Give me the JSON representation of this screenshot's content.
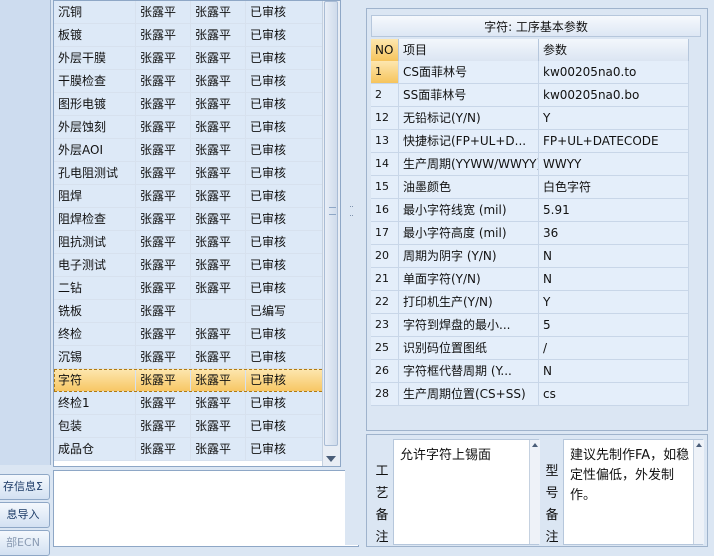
{
  "sidebar": {
    "buttons": [
      {
        "label": "存信息Σ"
      },
      {
        "label": "息导入"
      },
      {
        "label": "部ECN"
      }
    ]
  },
  "process_grid": {
    "rows": [
      {
        "step": "沉铜",
        "c1": "张露平",
        "c2": "张露平",
        "status": "已审核"
      },
      {
        "step": "板镀",
        "c1": "张露平",
        "c2": "张露平",
        "status": "已审核"
      },
      {
        "step": "外层干膜",
        "c1": "张露平",
        "c2": "张露平",
        "status": "已审核"
      },
      {
        "step": "干膜检查",
        "c1": "张露平",
        "c2": "张露平",
        "status": "已审核"
      },
      {
        "step": "图形电镀",
        "c1": "张露平",
        "c2": "张露平",
        "status": "已审核"
      },
      {
        "step": "外层蚀刻",
        "c1": "张露平",
        "c2": "张露平",
        "status": "已审核"
      },
      {
        "step": "外层AOI",
        "c1": "张露平",
        "c2": "张露平",
        "status": "已审核"
      },
      {
        "step": "孔电阻测试",
        "c1": "张露平",
        "c2": "张露平",
        "status": "已审核"
      },
      {
        "step": "阻焊",
        "c1": "张露平",
        "c2": "张露平",
        "status": "已审核"
      },
      {
        "step": "阻焊检查",
        "c1": "张露平",
        "c2": "张露平",
        "status": "已审核"
      },
      {
        "step": "阻抗测试",
        "c1": "张露平",
        "c2": "张露平",
        "status": "已审核"
      },
      {
        "step": "电子测试",
        "c1": "张露平",
        "c2": "张露平",
        "status": "已审核"
      },
      {
        "step": "二钻",
        "c1": "张露平",
        "c2": "张露平",
        "status": "已审核"
      },
      {
        "step": "铣板",
        "c1": "张露平",
        "c2": "",
        "status": "已编写"
      },
      {
        "step": "终检",
        "c1": "张露平",
        "c2": "张露平",
        "status": "已审核"
      },
      {
        "step": "沉锡",
        "c1": "张露平",
        "c2": "张露平",
        "status": "已审核"
      },
      {
        "step": "字符",
        "c1": "张露平",
        "c2": "张露平",
        "status": "已审核"
      },
      {
        "step": "终检1",
        "c1": "张露平",
        "c2": "张露平",
        "status": "已审核"
      },
      {
        "step": "包装",
        "c1": "张露平",
        "c2": "张露平",
        "status": "已审核"
      },
      {
        "step": "成品仓",
        "c1": "张露平",
        "c2": "张露平",
        "status": "已审核"
      }
    ],
    "selected_step": "字符"
  },
  "params": {
    "title": "字符: 工序基本参数",
    "headers": {
      "no": "NO",
      "item": "项目",
      "param": "参数"
    },
    "rows": [
      {
        "no": "1",
        "item": "CS面菲林号",
        "value": "kw00205na0.to"
      },
      {
        "no": "2",
        "item": "SS面菲林号",
        "value": "kw00205na0.bo"
      },
      {
        "no": "12",
        "item": "无铅标记(Y/N)",
        "value": "Y"
      },
      {
        "no": "13",
        "item": "快捷标记(FP+UL+D...",
        "value": "FP+UL+DATECODE"
      },
      {
        "no": "14",
        "item": "生产周期(YYWW/WWYY)",
        "value": "WWYY"
      },
      {
        "no": "15",
        "item": "油墨颜色",
        "value": "白色字符"
      },
      {
        "no": "16",
        "item": "最小字符线宽 (mil)",
        "value": "5.91"
      },
      {
        "no": "17",
        "item": "最小字符高度 (mil)",
        "value": "36"
      },
      {
        "no": "20",
        "item": "周期为阴字 (Y/N)",
        "value": "N"
      },
      {
        "no": "21",
        "item": "单面字符(Y/N)",
        "value": "N"
      },
      {
        "no": "22",
        "item": "打印机生产(Y/N)",
        "value": "Y"
      },
      {
        "no": "23",
        "item": "字符到焊盘的最小...",
        "value": "5"
      },
      {
        "no": "25",
        "item": "识别码位置图纸",
        "value": "/"
      },
      {
        "no": "26",
        "item": "字符框代替周期 (Y...",
        "value": "N"
      },
      {
        "no": "28",
        "item": "生产周期位置(CS+SS)",
        "value": "cs"
      }
    ]
  },
  "notes": {
    "process_label": "工艺备注",
    "process_text": "允许字符上锡面",
    "model_label": "型号备注",
    "model_text": "建议先制作FA，如稳定性偏低，外发制作。"
  }
}
